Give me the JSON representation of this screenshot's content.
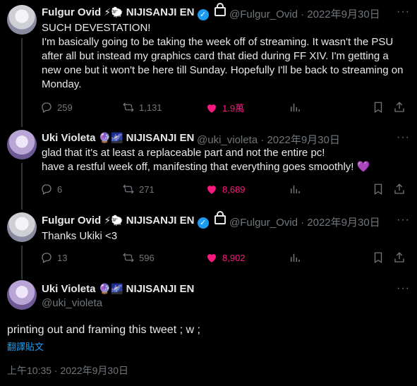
{
  "tweets": [
    {
      "name": "Fulgur Ovid",
      "emoji": "⚡🐑",
      "org": "NIJISANJI EN",
      "handle": "@Fulgur_Ovid",
      "date": "2022年9月30日",
      "text": "SUCH DEVESTATION!\nI'm basically going to be taking the week off of streaming. It wasn't the PSU after all but instead my graphics card that died during FF XIV. I'm getting a new one but it won't be here till Sunday. Hopefully I'll be back to streaming on Monday.",
      "replies": "259",
      "retweets": "1,131",
      "likes": "1.9萬"
    },
    {
      "name": "Uki Violeta",
      "emoji": "🔮🌌",
      "org": "NIJISANJI EN",
      "handle": "@uki_violeta",
      "date": "2022年9月30日",
      "text": "glad that it's at least a replaceable part and not the entire pc!\nhave a restful week off, manifesting that everything goes smoothly! 💜",
      "replies": "6",
      "retweets": "271",
      "likes": "8,689"
    },
    {
      "name": "Fulgur Ovid",
      "emoji": "⚡🐑",
      "org": "NIJISANJI EN",
      "handle": "@Fulgur_Ovid",
      "date": "2022年9月30日",
      "text": "Thanks Ukiki <3",
      "replies": "13",
      "retweets": "596",
      "likes": "8,902"
    }
  ],
  "main": {
    "name": "Uki Violeta",
    "emoji": "🔮🌌",
    "org": "NIJISANJI EN",
    "handle": "@uki_violeta",
    "text": "printing out and framing this tweet ; w ;",
    "translate": "翻譯貼文",
    "timestamp": "上午10:35 · 2022年9月30日"
  },
  "colors": {
    "background": "#000000",
    "text": "#e7e9ea",
    "muted": "#71767b",
    "like": "#f91880",
    "link": "#1d9bf0"
  },
  "icons": [
    "verified-icon",
    "lock-icon",
    "reply-icon",
    "retweet-icon",
    "like-icon",
    "views-icon",
    "bookmark-icon",
    "share-icon",
    "more-icon"
  ]
}
